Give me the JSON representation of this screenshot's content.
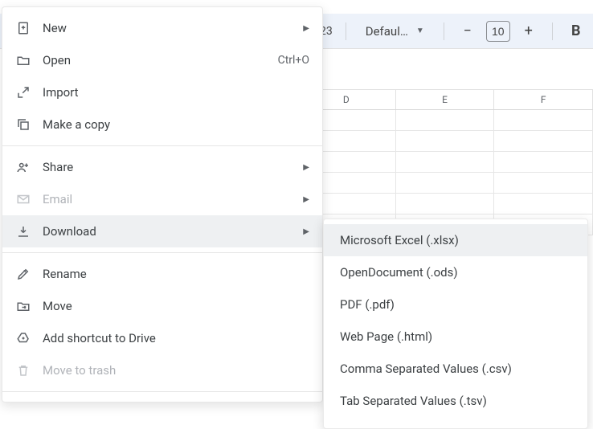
{
  "toolbar": {
    "num123": "23",
    "font_name": "Defaul…",
    "font_size": "10",
    "bold": "B"
  },
  "columns": [
    "D",
    "E",
    "F"
  ],
  "menu": {
    "new": "New",
    "open": "Open",
    "open_shortcut": "Ctrl+O",
    "import": "Import",
    "make_a_copy": "Make a copy",
    "share": "Share",
    "email": "Email",
    "download": "Download",
    "rename": "Rename",
    "move": "Move",
    "add_shortcut": "Add shortcut to Drive",
    "move_to_trash": "Move to trash"
  },
  "download_submenu": {
    "xlsx": "Microsoft Excel (.xlsx)",
    "ods": "OpenDocument (.ods)",
    "pdf": "PDF (.pdf)",
    "html": "Web Page (.html)",
    "csv": "Comma Separated Values (.csv)",
    "tsv": "Tab Separated Values (.tsv)"
  }
}
